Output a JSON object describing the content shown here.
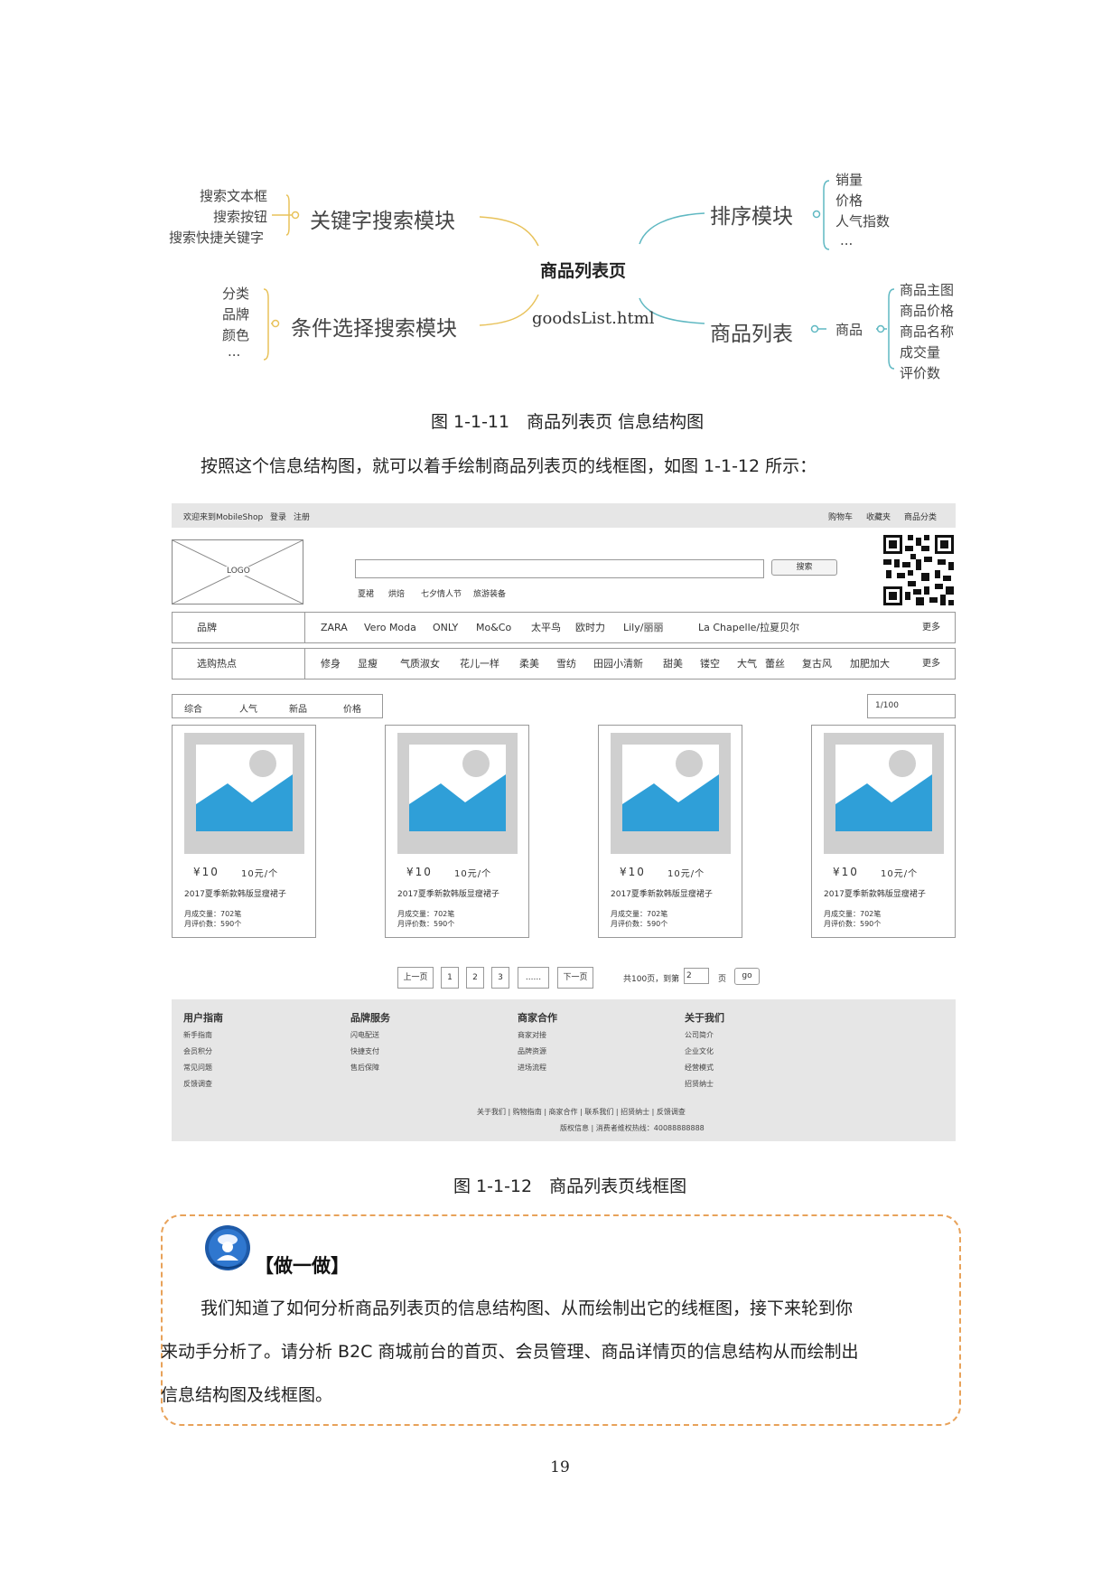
{
  "mindmap": {
    "center": "商品列表页",
    "file": "goodsList.html",
    "keyword_module": {
      "label": "关键字搜索模块",
      "items": [
        "搜索文本框",
        "搜索按钮",
        "搜索快捷关键字"
      ]
    },
    "condition_module": {
      "label": "条件选择搜索模块",
      "items": [
        "分类",
        "品牌",
        "颜色",
        "..."
      ]
    },
    "sort_module": {
      "label": "排序模块",
      "items": [
        "销量",
        "价格",
        "人气指数",
        "..."
      ]
    },
    "product_list": {
      "label": "商品列表",
      "sub": "商品",
      "items": [
        "商品主图",
        "商品价格",
        "商品名称",
        "成交量",
        "评价数"
      ]
    },
    "colors": {
      "left": "#e8c25a",
      "right": "#5fb8c2"
    }
  },
  "figure1_caption": "图 1-1-11　商品列表页  信息结构图",
  "intro_paragraph": "按照这个信息结构图，就可以着手绘制商品列表页的线框图，如图 1-1-12 所示：",
  "wireframe": {
    "topbar": {
      "welcome": "欢迎来到MobileShop",
      "login": "登录",
      "register": "注册",
      "right_links": [
        "购物车",
        "收藏夹",
        "商品分类"
      ]
    },
    "logo": "LOGO",
    "search_button": "搜索",
    "hot_keywords": [
      "夏裙",
      "烘焙",
      "七夕情人节",
      "旅游装备"
    ],
    "brand_filter": {
      "label": "品牌",
      "options": [
        "ZARA",
        "Vero Moda",
        "ONLY",
        "Mo&Co",
        "太平鸟",
        "欧时力",
        "Lily/丽丽",
        "La Chapelle/拉夏贝尔"
      ],
      "more": "更多"
    },
    "hot_filter": {
      "label": "选购热点",
      "options": [
        "修身",
        "显瘦",
        "气质淑女",
        "花儿一样",
        "柔美",
        "雪纺",
        "田园小清新",
        "甜美",
        "镂空",
        "大气",
        "蕾丝",
        "复古风",
        "加肥加大"
      ],
      "more": "更多"
    },
    "sort_options": [
      "综合",
      "人气",
      "新品",
      "价格"
    ],
    "page_indicator": "1/100",
    "product": {
      "price": "¥10",
      "unit_price": "10元/个",
      "title": "2017夏季新款韩版显瘦裙子",
      "monthly_sales": "月成交量：702笔",
      "monthly_reviews": "月评价数：590个"
    },
    "pagination": {
      "prev": "上一页",
      "pages": [
        "1",
        "2",
        "3",
        "......"
      ],
      "next": "下一页",
      "total": "共100页，到第",
      "goto_value": "2",
      "page_word": "页",
      "go": "go"
    },
    "footer": {
      "columns": [
        {
          "title": "用户指南",
          "items": [
            "新手指南",
            "会员积分",
            "常见问题",
            "反馈调查"
          ]
        },
        {
          "title": "品牌服务",
          "items": [
            "闪电配送",
            "快捷支付",
            "售后保障"
          ]
        },
        {
          "title": "商家合作",
          "items": [
            "商家对接",
            "品牌资源",
            "进场流程"
          ]
        },
        {
          "title": "关于我们",
          "items": [
            "公司简介",
            "企业文化",
            "经营模式",
            "招贤纳士"
          ]
        }
      ],
      "links_line": "关于我们 | 购物指南 | 商家合作 | 联系我们 | 招贤纳士 | 反馈调查",
      "copyright_line": "版权信息 | 消费者维权热线：40088888888"
    },
    "colors": {
      "bar": "#e6e6e6",
      "image_blue": "#2f9fd8",
      "image_gray": "#cfcfcf"
    }
  },
  "figure2_caption": "图 1-1-12　商品列表页线框图",
  "do_it": {
    "title": "【做一做】",
    "lines": [
      "我们知道了如何分析商品列表页的信息结构图、从而绘制出它的线框图，接下来轮到你",
      "来动手分析了。请分析 B2C 商城前台的首页、会员管理、商品详情页的信息结构从而绘制出",
      "信息结构图及线框图。"
    ],
    "border_color": "#e8a25a"
  },
  "page_number": "19"
}
